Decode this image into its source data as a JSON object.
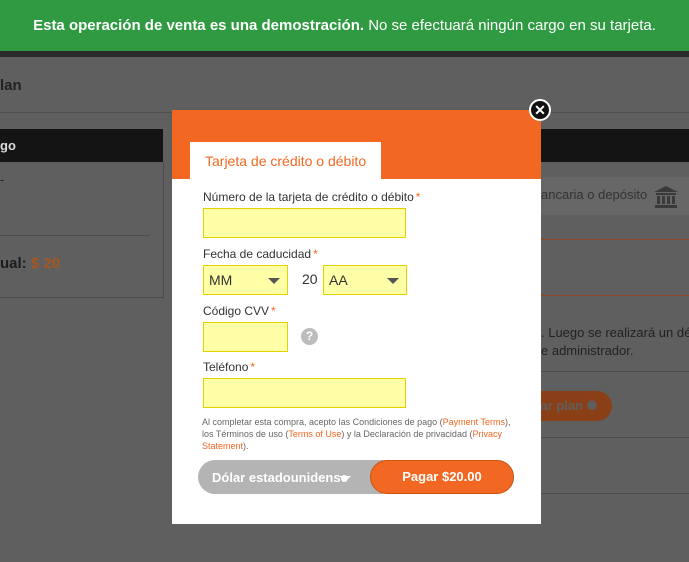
{
  "banner": {
    "bold_text": "Esta operación de venta es una demostración.",
    "text": " No se efectuará ningún cargo en su tarjeta."
  },
  "background": {
    "title": "lan",
    "left_panel": {
      "header": "go",
      "dash": "-",
      "total_label": "ual:",
      "total_amount": "$ 20"
    },
    "right_panel": {
      "tab_text": "ancaria o depósito",
      "icon": "bank-icon",
      "text_line1": ". Luego se realizará un dé",
      "text_line2": "e administrador.",
      "button_label": "ar plan"
    }
  },
  "modal": {
    "tab_label": "Tarjeta de crédito o débito",
    "close_icon": "close-icon",
    "card_number": {
      "label": "Número de la tarjeta de crédito o débito",
      "required": "*",
      "value": ""
    },
    "expiry": {
      "label": "Fecha de caducidad",
      "required": "*",
      "month_value": "MM",
      "year_prefix": "20",
      "year_value": "AA"
    },
    "cvv": {
      "label": "Código CVV",
      "required": "*",
      "value": "",
      "help_icon": "?"
    },
    "phone": {
      "label": "Teléfono",
      "required": "*",
      "value": ""
    },
    "terms": {
      "t1": "Al completar esta compra, acepto las Condiciones de pago (",
      "payment_terms": "Payment Terms",
      "t2": "), los Términos de uso (",
      "terms_of_use": "Terms of Use",
      "t3": ") y la Declaración de privacidad (",
      "privacy": "Privacy Statement",
      "t4": ")."
    },
    "currency_label": "Dólar estadounidense",
    "pay_label": "Pagar $20.00"
  },
  "colors": {
    "banner": "#2f9a41",
    "accent": "#f26822",
    "input_bg": "#ffffa8"
  }
}
